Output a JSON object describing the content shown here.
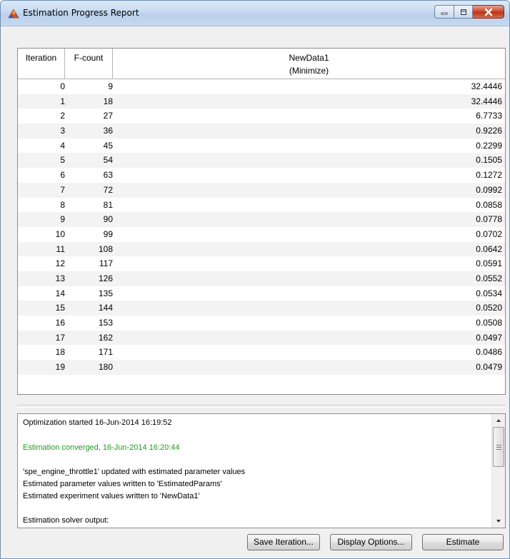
{
  "window": {
    "title": "Estimation Progress Report",
    "controls": {
      "minimize": "minimize",
      "maximize": "maximize",
      "close": "close"
    }
  },
  "table": {
    "headers": {
      "iteration": "Iteration",
      "fcount": "F-count",
      "data_name": "NewData1",
      "data_goal": "(Minimize)"
    },
    "rows": [
      {
        "iteration": "0",
        "fcount": "9",
        "value": "32.4446"
      },
      {
        "iteration": "1",
        "fcount": "18",
        "value": "32.4446"
      },
      {
        "iteration": "2",
        "fcount": "27",
        "value": "6.7733"
      },
      {
        "iteration": "3",
        "fcount": "36",
        "value": "0.9226"
      },
      {
        "iteration": "4",
        "fcount": "45",
        "value": "0.2299"
      },
      {
        "iteration": "5",
        "fcount": "54",
        "value": "0.1505"
      },
      {
        "iteration": "6",
        "fcount": "63",
        "value": "0.1272"
      },
      {
        "iteration": "7",
        "fcount": "72",
        "value": "0.0992"
      },
      {
        "iteration": "8",
        "fcount": "81",
        "value": "0.0858"
      },
      {
        "iteration": "9",
        "fcount": "90",
        "value": "0.0778"
      },
      {
        "iteration": "10",
        "fcount": "99",
        "value": "0.0702"
      },
      {
        "iteration": "11",
        "fcount": "108",
        "value": "0.0642"
      },
      {
        "iteration": "12",
        "fcount": "117",
        "value": "0.0591"
      },
      {
        "iteration": "13",
        "fcount": "126",
        "value": "0.0552"
      },
      {
        "iteration": "14",
        "fcount": "135",
        "value": "0.0534"
      },
      {
        "iteration": "15",
        "fcount": "144",
        "value": "0.0520"
      },
      {
        "iteration": "16",
        "fcount": "153",
        "value": "0.0508"
      },
      {
        "iteration": "17",
        "fcount": "162",
        "value": "0.0497"
      },
      {
        "iteration": "18",
        "fcount": "171",
        "value": "0.0486"
      },
      {
        "iteration": "19",
        "fcount": "180",
        "value": "0.0479"
      }
    ]
  },
  "log": {
    "lines": [
      {
        "text": "Optimization started 16-Jun-2014 16:19:52",
        "style": "normal"
      },
      {
        "text": "Estimation converged, 16-Jun-2014 16:20:44",
        "style": "green"
      },
      {
        "text": "'spe_engine_throttle1' updated with estimated parameter values",
        "style": "normal"
      },
      {
        "text": "Estimated parameter values written to 'EstimatedParams'",
        "style": "normal"
      },
      {
        "text": "Estimated experiment values written to 'NewData1'",
        "style": "normal"
      },
      {
        "text": "Estimation solver output:",
        "style": "normal"
      }
    ],
    "success_color": "#1f9b1f"
  },
  "buttons": {
    "save_iteration": "Save Iteration...",
    "display_options": "Display Options...",
    "estimate": "Estimate"
  },
  "colors": {
    "titlebar": "#c6daf0",
    "close_button": "#c8432a",
    "window_bg": "#f0f0f0"
  }
}
